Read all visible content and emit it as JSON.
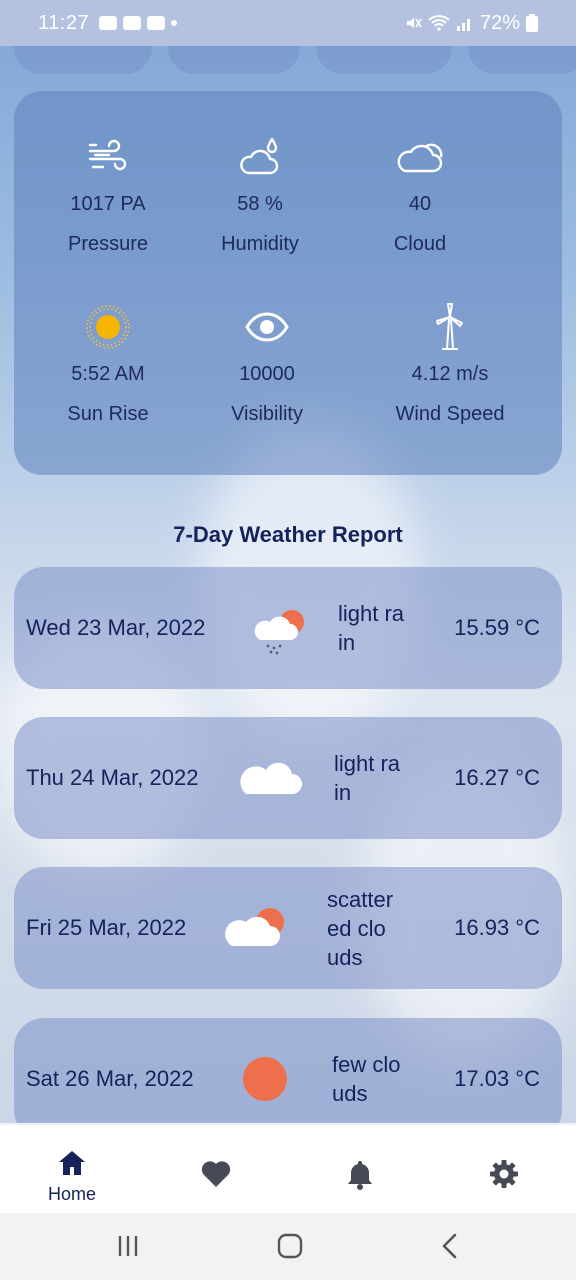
{
  "status_bar": {
    "time": "11:27",
    "battery": "72%"
  },
  "details": [
    {
      "icon": "wind-icon",
      "value": "1017 PA",
      "label": "Pressure"
    },
    {
      "icon": "humidity-cloud-icon",
      "value": "58 %",
      "label": "Humidity"
    },
    {
      "icon": "cloud-icon",
      "value": "40",
      "label": "Cloud"
    },
    {
      "icon": "sun-icon",
      "value": "5:52 AM",
      "label": "Sun Rise"
    },
    {
      "icon": "eye-icon",
      "value": "10000",
      "label": "Visibility"
    },
    {
      "icon": "wind-turbine-icon",
      "value": "4.12 m/s",
      "label": "Wind Speed"
    }
  ],
  "report": {
    "title": "7-Day Weather Report",
    "days": [
      {
        "date": "Wed 23 Mar, 2022",
        "icon": "rain-cloud-sun-icon",
        "desc": "light rain",
        "temp": "15.59 °C"
      },
      {
        "date": "Thu 24 Mar, 2022",
        "icon": "cloud-icon",
        "desc": "light rain",
        "temp": "16.27 °C"
      },
      {
        "date": "Fri 25 Mar, 2022",
        "icon": "cloud-sun-icon",
        "desc": "scattered clouds",
        "temp": "16.93 °C"
      },
      {
        "date": "Sat 26 Mar, 2022",
        "icon": "sun-disc-icon",
        "desc": "few clouds",
        "temp": "17.03 °C"
      }
    ]
  },
  "bottom_nav": {
    "home_label": "Home"
  },
  "colors": {
    "accent": "#16225a",
    "sun": "#f5b400",
    "sun_disc": "#ee6f4c"
  }
}
